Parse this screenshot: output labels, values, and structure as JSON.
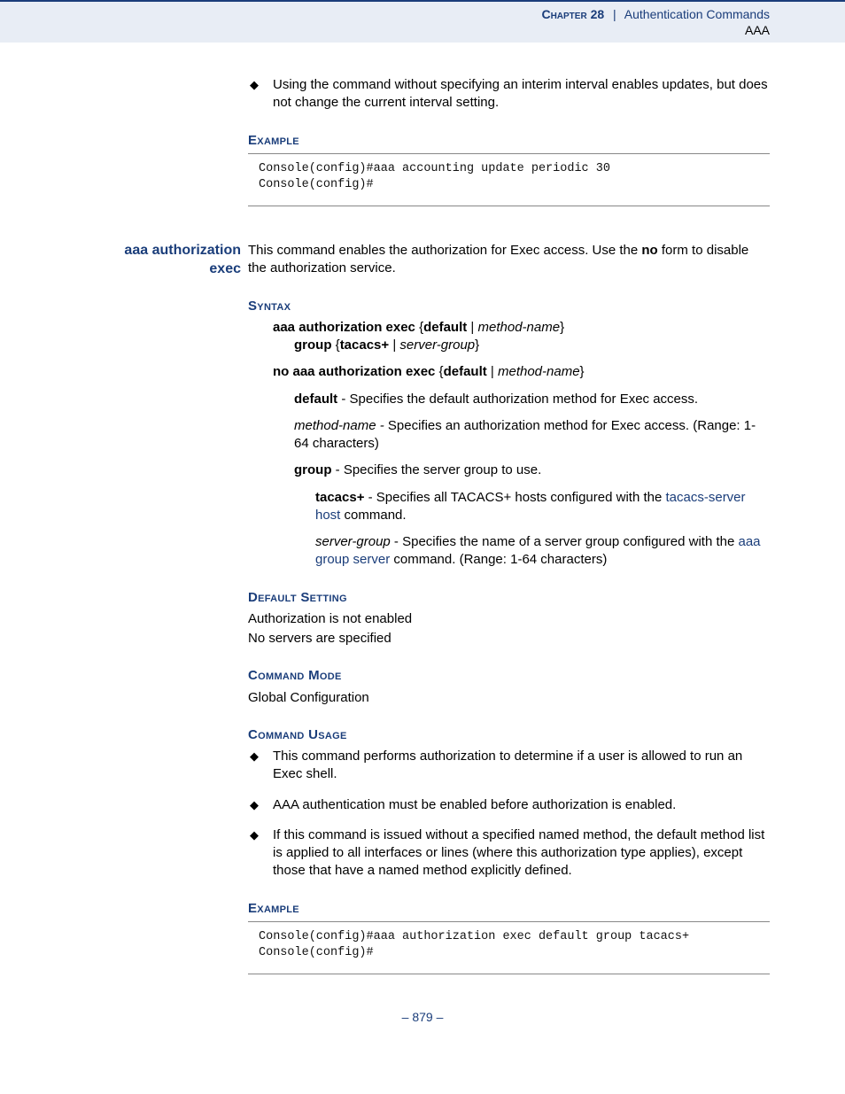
{
  "header": {
    "chapter_label": "Chapter 28",
    "separator": "|",
    "title": "Authentication Commands",
    "subtitle": "AAA"
  },
  "block1": {
    "bullet1": "Using the command without specifying an interim interval enables updates, but does not change the current interval setting.",
    "example_label": "Example",
    "code": "Console(config)#aaa accounting update periodic 30\nConsole(config)#"
  },
  "block2": {
    "cmd_name_line1": "aaa authorization",
    "cmd_name_line2": "exec",
    "intro_pre": "This command enables the authorization for Exec access. Use the ",
    "intro_bold": "no",
    "intro_post": " form to disable the authorization service.",
    "syntax_label": "Syntax",
    "syn_line1_b1": "aaa authorization exec",
    "syn_line1_brace1": " {",
    "syn_line1_b2": "default",
    "syn_line1_pipe": " | ",
    "syn_line1_i1": "method-name",
    "syn_line1_brace2": "}",
    "syn_line2_b1": "group",
    "syn_line2_brace1": " {",
    "syn_line2_b2": "tacacs+",
    "syn_line2_pipe": " | ",
    "syn_line2_i1": "server-group",
    "syn_line2_brace2": "}",
    "syn_line3_b1": "no aaa authorization exec",
    "syn_line3_brace1": " {",
    "syn_line3_b2": "default",
    "syn_line3_pipe": " | ",
    "syn_line3_i1": "method-name",
    "syn_line3_brace2": "}",
    "def_b": "default",
    "def_txt": " - Specifies the default authorization method for Exec access.",
    "method_i": "method-name - ",
    "method_txt": "Specifies an authorization method for Exec access. (Range: 1-64 characters)",
    "group_b": "group",
    "group_txt": " - Specifies the server group to use.",
    "tacacs_b": "tacacs+",
    "tacacs_mid": " - Specifies all TACACS+ hosts configured with the ",
    "tacacs_link": "tacacs-server host",
    "tacacs_post": " command.",
    "sg_i": "server-group",
    "sg_mid": " - Specifies the name of a server group configured with the ",
    "sg_link": "aaa group server",
    "sg_post": " command. (Range: 1-64 characters)",
    "default_setting_label": "Default Setting",
    "ds_line1": "Authorization is not enabled",
    "ds_line2": "No servers are specified",
    "command_mode_label": "Command Mode",
    "cm_line": "Global Configuration",
    "command_usage_label": "Command Usage",
    "cu_b1": "This command performs authorization to determine if a user is allowed to run an Exec shell.",
    "cu_b2": "AAA authentication must be enabled before authorization is enabled.",
    "cu_b3": "If this command is issued without a specified named method, the default method list is applied to all interfaces or lines (where this authorization type applies), except those that have a named method explicitly defined.",
    "example_label": "Example",
    "code": "Console(config)#aaa authorization exec default group tacacs+\nConsole(config)#"
  },
  "footer": {
    "page": "– 879 –"
  }
}
